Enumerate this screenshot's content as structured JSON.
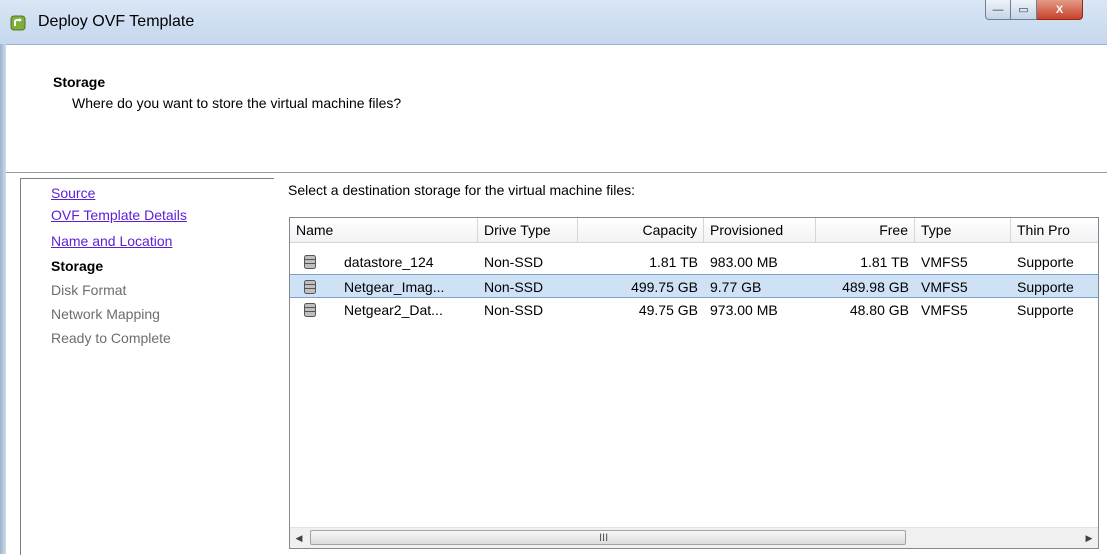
{
  "window": {
    "title": "Deploy OVF Template",
    "buttons": {
      "minimize": "—",
      "maximize": "▭",
      "close": "X"
    }
  },
  "header": {
    "title": "Storage",
    "subtitle": "Where do you want to store the virtual machine files?"
  },
  "nav": {
    "items": [
      {
        "label": "Source",
        "state": "link"
      },
      {
        "label": "OVF Template Details",
        "state": "link"
      },
      {
        "label": "Name and Location",
        "state": "link"
      },
      {
        "label": "Storage",
        "state": "current"
      },
      {
        "label": "Disk Format",
        "state": "disabled"
      },
      {
        "label": "Network Mapping",
        "state": "disabled"
      },
      {
        "label": "Ready to Complete",
        "state": "disabled"
      }
    ]
  },
  "content": {
    "prompt": "Select a destination storage for the virtual machine files:"
  },
  "table": {
    "columns": [
      "Name",
      "Drive Type",
      "Capacity",
      "Provisioned",
      "Free",
      "Type",
      "Thin Pro"
    ],
    "rows": [
      {
        "name": "datastore_124",
        "drive_type": "Non-SSD",
        "capacity": "1.81 TB",
        "provisioned": "983.00 MB",
        "free": "1.81 TB",
        "type": "VMFS5",
        "thin": "Supporte"
      },
      {
        "name": "Netgear_Imag...",
        "drive_type": "Non-SSD",
        "capacity": "499.75 GB",
        "provisioned": "9.77 GB",
        "free": "489.98 GB",
        "type": "VMFS5",
        "thin": "Supporte"
      },
      {
        "name": "Netgear2_Dat...",
        "drive_type": "Non-SSD",
        "capacity": "49.75 GB",
        "provisioned": "973.00 MB",
        "free": "48.80 GB",
        "type": "VMFS5",
        "thin": "Supporte"
      }
    ],
    "selected_row": 1
  },
  "scrollbar": {
    "left_arrow": "◀",
    "right_arrow": "▶",
    "grip": "III"
  },
  "icons": {
    "app": "ovf-app-icon",
    "datastore": "database-icon"
  },
  "colors": {
    "link": "#5a1fd6",
    "selection": "#cfe2f5",
    "close": "#c8422a"
  }
}
